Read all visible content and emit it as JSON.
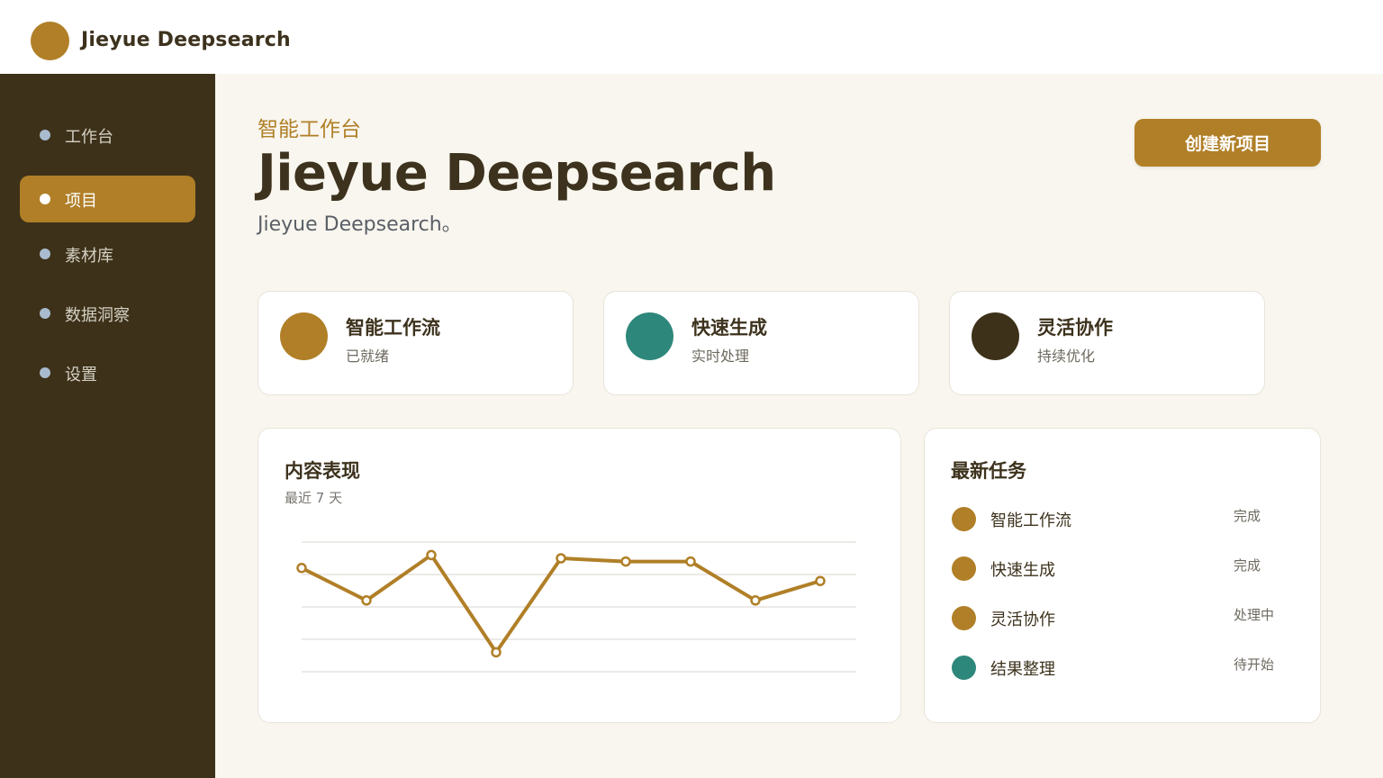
{
  "app": {
    "brand": "Jieyue Deepsearch",
    "accent": "#b07f27",
    "sidebar_bg": "#3d3119"
  },
  "sidebar": {
    "items": [
      {
        "label": "工作台",
        "active": false
      },
      {
        "label": "项目",
        "active": true
      },
      {
        "label": "素材库",
        "active": false
      },
      {
        "label": "数据洞察",
        "active": false
      },
      {
        "label": "设置",
        "active": false
      }
    ]
  },
  "hero": {
    "kicker": "智能工作台",
    "title": "Jieyue Deepsearch",
    "subtitle": "Jieyue Deepsearch。",
    "cta_label": "创建新项目"
  },
  "features": [
    {
      "title": "智能工作流",
      "subtitle": "已就绪",
      "color": "#b07f27"
    },
    {
      "title": "快速生成",
      "subtitle": "实时处理",
      "color": "#2e877b"
    },
    {
      "title": "灵活协作",
      "subtitle": "持续优化",
      "color": "#3d3119"
    }
  ],
  "performance": {
    "title": "内容表现",
    "subtitle": "最近 7 天",
    "chart_data": {
      "type": "line",
      "x": [
        1,
        2,
        3,
        4,
        5,
        6,
        7,
        8,
        9
      ],
      "values": [
        72,
        62,
        76,
        46,
        75,
        74,
        74,
        62,
        68
      ],
      "ylim": [
        40,
        80
      ],
      "grid": true,
      "color": "#b07f27"
    }
  },
  "tasks": {
    "title": "最新任务",
    "items": [
      {
        "name": "智能工作流",
        "status": "完成",
        "color": "#b07f27"
      },
      {
        "name": "快速生成",
        "status": "完成",
        "color": "#b07f27"
      },
      {
        "name": "灵活协作",
        "status": "处理中",
        "color": "#b07f27"
      },
      {
        "name": "结果整理",
        "status": "待开始",
        "color": "#2e877b"
      }
    ]
  }
}
